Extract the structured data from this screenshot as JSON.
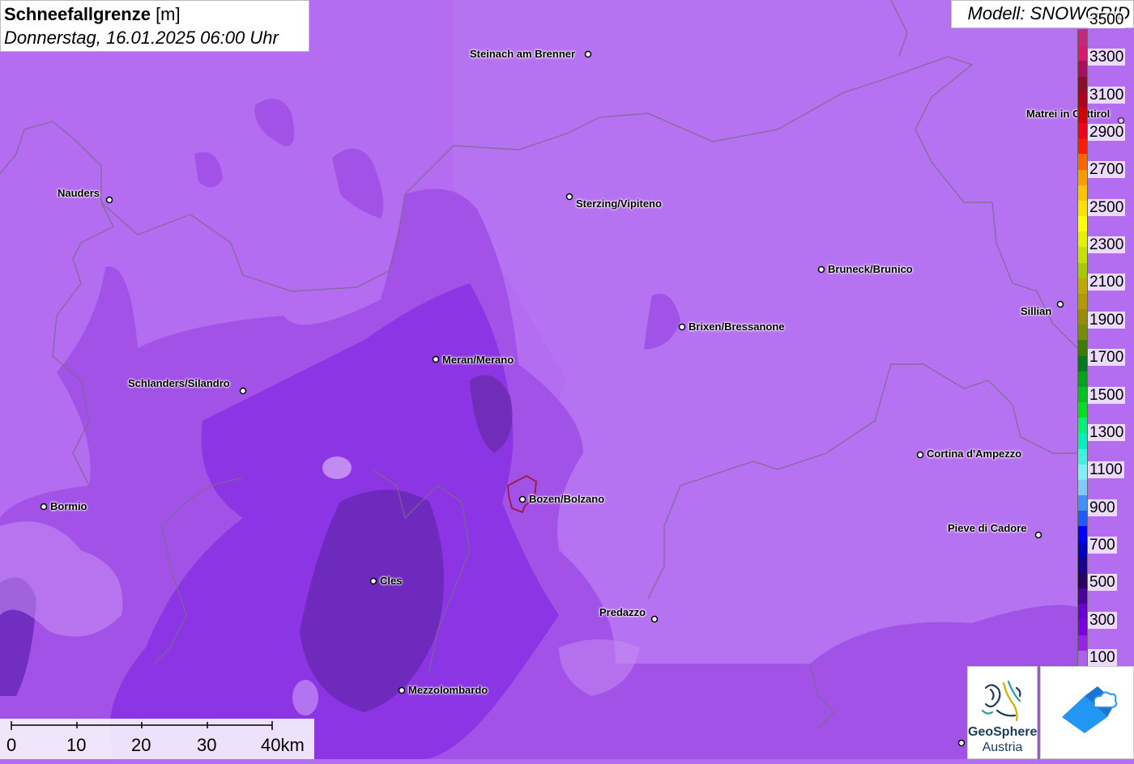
{
  "header": {
    "title_bold": "Schneefallgrenze",
    "title_unit": " [m]",
    "datetime": "Donnerstag, 16.01.2025 06:00 Uhr",
    "model": "Modell: SNOWGRID"
  },
  "legend": {
    "labels": [
      "3500",
      "3300",
      "3100",
      "2900",
      "2700",
      "2500",
      "2300",
      "2100",
      "1900",
      "1700",
      "1500",
      "1300",
      "1100",
      "900",
      "700",
      "500",
      "300",
      "100"
    ],
    "colors": [
      "#c8267e",
      "#d9196e",
      "#a80f5e",
      "#8a0d2a",
      "#b3001c",
      "#d30008",
      "#f4001c",
      "#ff1a00",
      "#ff6600",
      "#ff9a00",
      "#ffc400",
      "#ffe100",
      "#ffff00",
      "#e6f000",
      "#c6e000",
      "#a8c800",
      "#c4a800",
      "#b39a00",
      "#9a8c00",
      "#7a8c00",
      "#3d7a00",
      "#007a1e",
      "#00a31e",
      "#00c31e",
      "#00e01e",
      "#00f07a",
      "#00f0c0",
      "#40f0e0",
      "#80f0ff",
      "#80c8ff",
      "#4090ff",
      "#1e5aff",
      "#0000ff",
      "#0000c0",
      "#1a0090",
      "#2a0060",
      "#4a00a0",
      "#6a00d0",
      "#7a00e0",
      "#9a20e8",
      "#b060f0"
    ]
  },
  "cities": [
    {
      "name": "Steinach am Brenner"
    },
    {
      "name": "Nauders"
    },
    {
      "name": "Sterzing/Vipiteno"
    },
    {
      "name": "Matrei in Osttirol"
    },
    {
      "name": "Bruneck/Brunico"
    },
    {
      "name": "Sillian"
    },
    {
      "name": "Brixen/Bressanone"
    },
    {
      "name": "Meran/Merano"
    },
    {
      "name": "Schlanders/Silandro"
    },
    {
      "name": "Cortina d'Ampezzo"
    },
    {
      "name": "Bormio"
    },
    {
      "name": "Bozen/Bolzano"
    },
    {
      "name": "Pieve di Cadore"
    },
    {
      "name": "Cles"
    },
    {
      "name": "Predazzo"
    },
    {
      "name": "Mezzolombardo"
    }
  ],
  "scale": {
    "labels": [
      "0",
      "10",
      "20",
      "30",
      "40km"
    ]
  },
  "logos": {
    "geosphere_line1": "GeoSphere",
    "geosphere_line2": "Austria"
  }
}
